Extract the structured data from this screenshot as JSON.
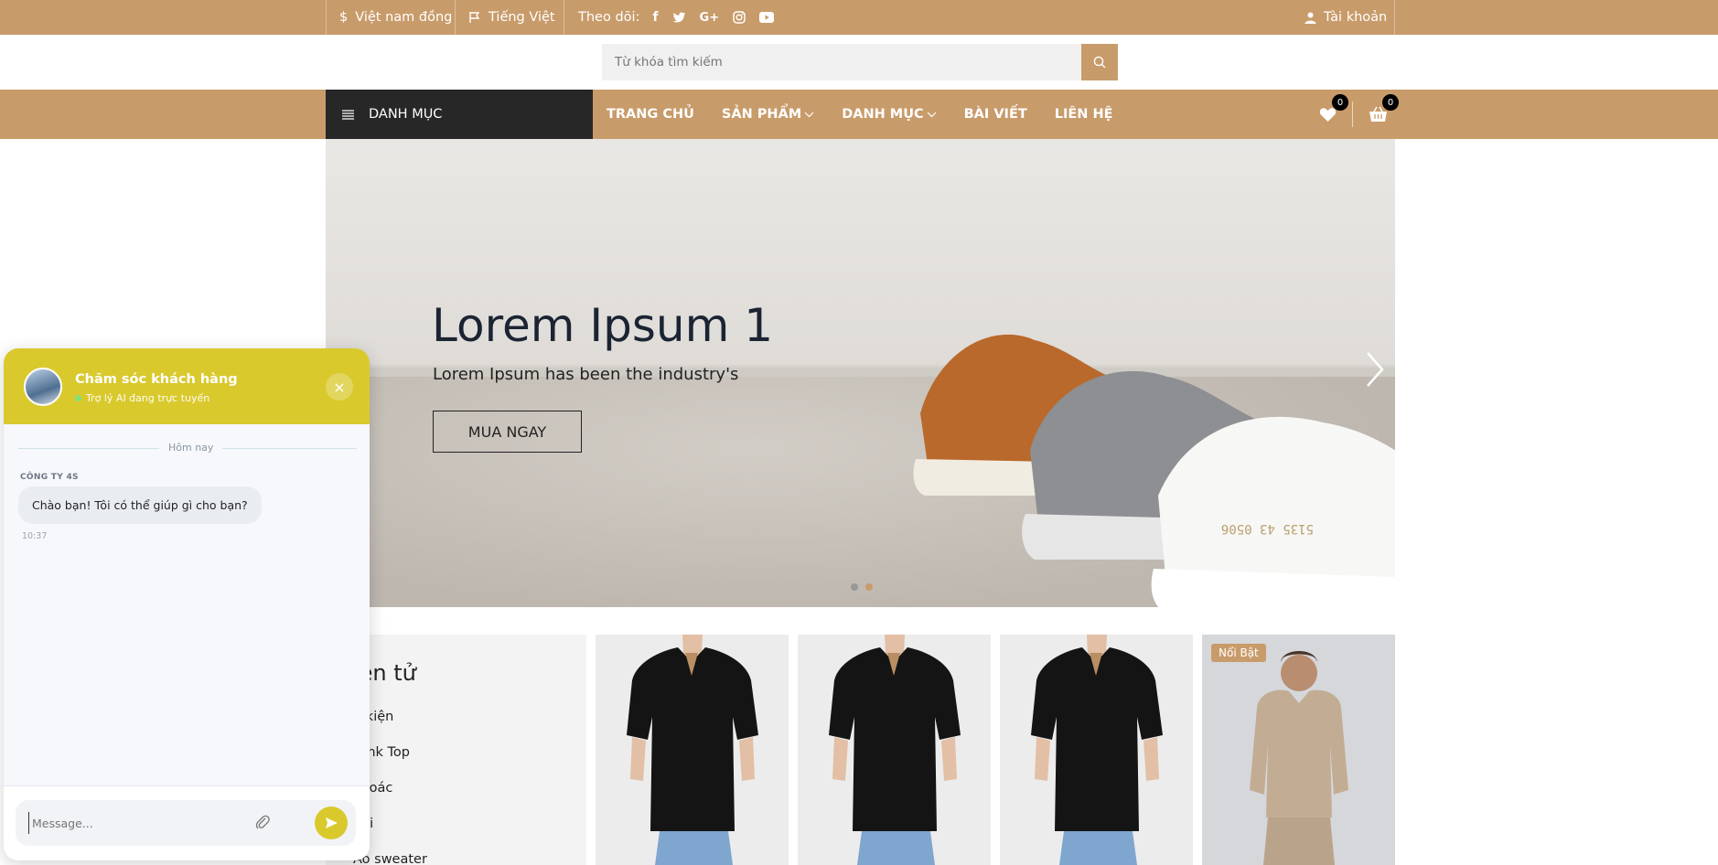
{
  "topbar": {
    "currency": "Việt nam đồng",
    "language": "Tiếng Việt",
    "follow_label": "Theo dõi:",
    "social": [
      "facebook-icon",
      "twitter-icon",
      "google-plus-icon",
      "instagram-icon",
      "youtube-icon"
    ],
    "account": "Tài khoản"
  },
  "search": {
    "placeholder": "Từ khóa tìm kiếm"
  },
  "nav": {
    "categories_button": "DANH MỤC",
    "links": [
      "TRANG CHỦ",
      "SẢN PHẨM",
      "DANH MỤC",
      "BÀI VIẾT",
      "LIÊN HỆ"
    ],
    "wishlist_count": "0",
    "cart_count": "0"
  },
  "hero": {
    "title": "Lorem Ipsum 1",
    "subtitle": "Lorem Ipsum has been the industry's",
    "cta": "MUA NGAY",
    "slides": 2,
    "active_slide": 2
  },
  "category_panel": {
    "title": "iện tử",
    "items": [
      "ụ kiện",
      "Tank Top",
      "khoác",
      "bơi",
      "Áo sweater"
    ]
  },
  "products": [
    {
      "badge": ""
    },
    {
      "badge": ""
    },
    {
      "badge": ""
    },
    {
      "badge": "Nổi Bật"
    }
  ],
  "chat": {
    "title": "Chăm sóc khách hàng",
    "status": "Trợ lý AI đang trực tuyến",
    "day_label": "Hôm nay",
    "sender": "CÔNG TY 4S",
    "message": "Chào bạn! Tôi có thể giúp gì cho bạn?",
    "time": "10:37",
    "input_placeholder": "Message..."
  },
  "colors": {
    "brand": "#c89b6a",
    "dark": "#272727",
    "chat_accent": "#d9c92d"
  }
}
